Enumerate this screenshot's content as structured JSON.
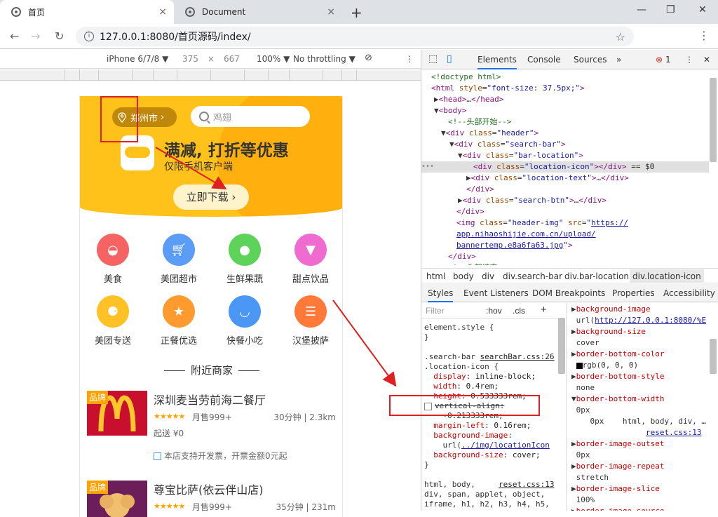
{
  "browser": {
    "tabs": [
      {
        "label": "首页"
      },
      {
        "label": "Document"
      }
    ],
    "url": "127.0.0.1:8080/首页源码/index/",
    "tab_close": "×",
    "new_tab": "+"
  },
  "device_toolbar": {
    "device": "iPhone 6/7/8 ▼",
    "width": "375",
    "times": "×",
    "height": "667",
    "zoom": "100% ▼",
    "throttle": "No throttling ▼"
  },
  "app": {
    "location": "郑州市",
    "search_placeholder": "鸡翅",
    "headline": "满减, 打折等优惠",
    "subline": "仅限手机客户端",
    "download_btn": "立即下载 ›",
    "categories": [
      {
        "label": "美食",
        "color": "#f56363"
      },
      {
        "label": "美团超市",
        "color": "#5b9cf6"
      },
      {
        "label": "生鲜果蔬",
        "color": "#5dd35a"
      },
      {
        "label": "甜点饮品",
        "color": "#f06bd0"
      },
      {
        "label": "美团专送",
        "color": "#ffc226"
      },
      {
        "label": "正餐优选",
        "color": "#ff9a2e"
      },
      {
        "label": "快餐小吃",
        "color": "#4a97f5"
      },
      {
        "label": "汉堡披萨",
        "color": "#ff7a38"
      }
    ],
    "nearby_title": "附近商家",
    "shops": [
      {
        "brand": "品牌",
        "name": "深圳麦当劳前海二餐厅",
        "stars": "★★★★★",
        "sold": "月售999+",
        "time": "30分钟 | 2.3km",
        "fee": "起送 ¥0",
        "invoice": "本店支持开发票，开票金额0元起"
      },
      {
        "brand": "品牌",
        "name": "尊宝比萨(依云伴山店)",
        "stars": "★★★★★",
        "sold": "月售999+",
        "time": "35分钟 | 231m"
      }
    ]
  },
  "devtools": {
    "tabs": [
      "Elements",
      "Console",
      "Sources",
      "»"
    ],
    "error_count": "1",
    "dom_lines": [
      {
        "html": "<span class='cmt'>&lt;!doctype html&gt;</span>"
      },
      {
        "html": "<span class='tag'>&lt;html</span> <span class='attr'>style</span>=<span class='val'>\"font-size: 37.5px;\"</span><span class='tag'>&gt;</span>"
      },
      {
        "html": "▶<span class='tag'>&lt;head&gt;</span>…<span class='tag'>&lt;/head&gt;</span>"
      },
      {
        "html": "▼<span class='tag'>&lt;body&gt;</span>"
      },
      {
        "html": "<span class='cmt'>&lt;!--头部开始--&gt;</span>"
      },
      {
        "html": "▼<span class='tag'>&lt;div</span> <span class='attr'>class</span>=<span class='val'>\"header\"</span><span class='tag'>&gt;</span>"
      },
      {
        "html": "▼<span class='tag'>&lt;div</span> <span class='attr'>class</span>=<span class='val'>\"search-bar\"</span><span class='tag'>&gt;</span>"
      },
      {
        "html": "▼<span class='tag'>&lt;div</span> <span class='attr'>class</span>=<span class='val'>\"bar-location\"</span><span class='tag'>&gt;</span>"
      },
      {
        "html": "<span class='tag'>&lt;div</span> <span class='attr'>class</span>=<span class='val'>\"location-icon\"</span><span class='tag'>&gt;&lt;/div&gt;</span> <span class='txt'>== $0</span>"
      },
      {
        "html": "▶<span class='tag'>&lt;div</span> <span class='attr'>class</span>=<span class='val'>\"location-text\"</span><span class='tag'>&gt;</span>…<span class='tag'>&lt;/div&gt;</span>"
      },
      {
        "html": "<span class='tag'>&lt;/div&gt;</span>"
      },
      {
        "html": "▶<span class='tag'>&lt;div</span> <span class='attr'>class</span>=<span class='val'>\"search-btn\"</span><span class='tag'>&gt;</span>…<span class='tag'>&lt;/div&gt;</span>"
      },
      {
        "html": "<span class='tag'>&lt;/div&gt;</span>"
      },
      {
        "html": "<span class='tag'>&lt;img</span> <span class='attr'>class</span>=<span class='val'>\"header-img\"</span> <span class='attr'>src</span>=<span class='val'>\"<u>https://</u></span>"
      },
      {
        "html": "<span class='val'><u>app.nihaoshijie.com.cn/upload/</u></span>"
      },
      {
        "html": "<span class='val'><u>bannertemp.e8a6fa63.jpg</u>\"</span><span class='tag'>&gt;</span>"
      },
      {
        "html": "<span class='tag'>&lt;/div&gt;</span>"
      },
      {
        "html": "<span class='cmt'>&lt;!--头部结束--&gt;</span>"
      }
    ],
    "breadcrumbs": [
      "html",
      "body",
      "div",
      "div.search-bar",
      "div.bar-location",
      "div.location-icon"
    ],
    "styles_tabs": [
      "Styles",
      "Event Listeners",
      "DOM Breakpoints",
      "Properties",
      "Accessibility"
    ],
    "filter_placeholder": "Filter",
    "hov": ":hov",
    "cls": ".cls",
    "add": "+",
    "style_lines": [
      {
        "html": "element.style {"
      },
      {
        "html": "}"
      },
      {
        "html": ""
      },
      {
        "html": ".search-bar <span class='link' style='color:#222'>searchBar.css:26</span>"
      },
      {
        "html": ".location-icon {"
      },
      {
        "html": "&nbsp;&nbsp;<span class='prop'>display</span>: <span class='pval'>inline-block;</span>"
      },
      {
        "html": "&nbsp;&nbsp;<span class='prop'>width</span>: <span class='pval'>0.4rem;</span>"
      },
      {
        "html": "&nbsp;&nbsp;<span class='prop'>height</span>: <span class='pval'>0.533333rem;</span>"
      },
      {
        "html": "<span class='chk'></span><span class='strike'>vertical-align:</span>"
      },
      {
        "html": "&nbsp;&nbsp;&nbsp;&nbsp;<span class='strike'>-0.213333rem;</span>"
      },
      {
        "html": "&nbsp;&nbsp;<span class='prop'>margin-left</span>: <span class='pval'>0.16rem;</span>"
      },
      {
        "html": "&nbsp;&nbsp;<span class='prop'>background-image</span>:"
      },
      {
        "html": "&nbsp;&nbsp;&nbsp;&nbsp;url(<span class='link'>../img/locationIcon</span>"
      },
      {
        "html": "&nbsp;&nbsp;<span class='prop'>background-size</span>: <span class='pval'>cover;</span>"
      },
      {
        "html": "}"
      },
      {
        "html": ""
      },
      {
        "html": "html, body, &nbsp;&nbsp;&nbsp;&nbsp;<span class='link' style='color:#222'>reset.css:13</span>"
      },
      {
        "html": "div, span, applet, object,"
      },
      {
        "html": "iframe, h1, h2, h3, h4, h5,"
      },
      {
        "html": "h6, p, blockquote, pre, a,"
      }
    ],
    "computed_lines": [
      {
        "html": "▶<span class='prop'>background-image</span>"
      },
      {
        "html": "&nbsp;url(<span class='link'>http://127.0.0.1:8080/%E</span>"
      },
      {
        "html": "▶<span class='prop'>background-size</span>"
      },
      {
        "html": "&nbsp;cover"
      },
      {
        "html": "▶<span class='prop'>border-bottom-color</span>"
      },
      {
        "html": "&nbsp;<span style='display:inline-block;width:9px;height:9px;background:#000;vertical-align:middle'></span>rgb(0, 0, 0)"
      },
      {
        "html": "▶<span class='prop'>border-bottom-style</span>"
      },
      {
        "html": "&nbsp;none"
      },
      {
        "html": "▼<span class='prop'>border-bottom-width</span>"
      },
      {
        "html": "&nbsp;0px"
      },
      {
        "html": "&nbsp;&nbsp;&nbsp;&nbsp;0px &nbsp;&nbsp;&nbsp;html, body, div, …"
      },
      {
        "html": "&nbsp;&nbsp;&nbsp;&nbsp;&nbsp;&nbsp;&nbsp;&nbsp;&nbsp;&nbsp;&nbsp;&nbsp;&nbsp;&nbsp;&nbsp;&nbsp;<span class='link'>reset.css:13</span>"
      },
      {
        "html": "▶<span class='prop'>border-image-outset</span>"
      },
      {
        "html": "&nbsp;0px"
      },
      {
        "html": "▶<span class='prop'>border-image-repeat</span>"
      },
      {
        "html": "&nbsp;stretch"
      },
      {
        "html": "▶<span class='prop'>border-image-slice</span>"
      },
      {
        "html": "&nbsp;100%"
      },
      {
        "html": "▶<span class='prop'>border-image-source</span>"
      }
    ]
  },
  "colors": {
    "accent": "#1a73e8",
    "banner": "#ffc21a",
    "annotation": "#e02020"
  }
}
